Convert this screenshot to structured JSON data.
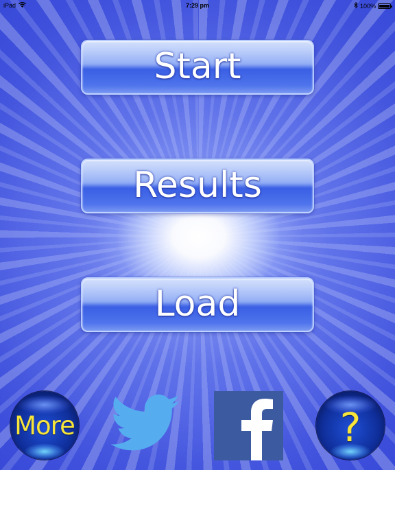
{
  "status_bar": {
    "device": "iPad",
    "time": "7:29 pm",
    "battery_percent": "100%"
  },
  "menu": {
    "start_label": "Start",
    "results_label": "Results",
    "load_label": "Load"
  },
  "bottom_bar": {
    "more_label": "More",
    "help_label": "?"
  },
  "colors": {
    "background_blue": "#3f52dc",
    "button_blue": "#4f74ec",
    "orb_text_yellow": "#f6e43a",
    "twitter_blue": "#55acee",
    "facebook_blue": "#3b5aa0"
  },
  "icons": {
    "status_wifi": "wifi-icon",
    "status_bluetooth": "bluetooth-icon",
    "status_battery": "battery-icon",
    "twitter": "twitter-bird-icon",
    "facebook": "facebook-f-icon"
  }
}
